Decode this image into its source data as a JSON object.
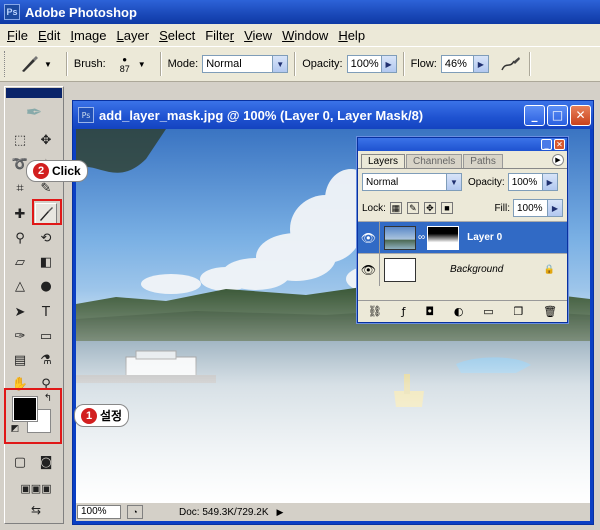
{
  "app": {
    "title": "Adobe Photoshop",
    "icon": "photoshop-icon"
  },
  "menu": [
    {
      "pre": "",
      "ul": "F",
      "post": "ile"
    },
    {
      "pre": "",
      "ul": "E",
      "post": "dit"
    },
    {
      "pre": "",
      "ul": "I",
      "post": "mage"
    },
    {
      "pre": "",
      "ul": "L",
      "post": "ayer"
    },
    {
      "pre": "",
      "ul": "S",
      "post": "elect"
    },
    {
      "pre": "Filte",
      "ul": "r",
      "post": ""
    },
    {
      "pre": "",
      "ul": "V",
      "post": "iew"
    },
    {
      "pre": "",
      "ul": "W",
      "post": "indow"
    },
    {
      "pre": "",
      "ul": "H",
      "post": "elp"
    }
  ],
  "options": {
    "brush_label": "Brush:",
    "brush_size": "87",
    "mode_label": "Mode:",
    "mode_value": "Normal",
    "opacity_label": "Opacity:",
    "opacity_value": "100%",
    "flow_label": "Flow:",
    "flow_value": "46%"
  },
  "document": {
    "title": "add_layer_mask.jpg @ 100% (Layer 0, Layer Mask/8)",
    "zoom": "100%",
    "doc_info": "Doc: 549.3K/729.2K"
  },
  "layers_palette": {
    "tabs": [
      "Layers",
      "Channels",
      "Paths"
    ],
    "blend_mode": "Normal",
    "opacity_label": "Opacity:",
    "opacity_value": "100%",
    "lock_label": "Lock:",
    "fill_label": "Fill:",
    "fill_value": "100%",
    "layers": [
      {
        "name": "Layer 0",
        "selected": true,
        "has_mask": true
      },
      {
        "name": "Background",
        "selected": false,
        "locked": true
      }
    ]
  },
  "annotations": {
    "step1_num": "1",
    "step1_text": "설정",
    "step2_num": "2",
    "step2_text": "Click"
  },
  "colors": {
    "foreground": "#000000",
    "background": "#ffffff",
    "accent": "#316ac5",
    "callout": "#d21f1f"
  }
}
